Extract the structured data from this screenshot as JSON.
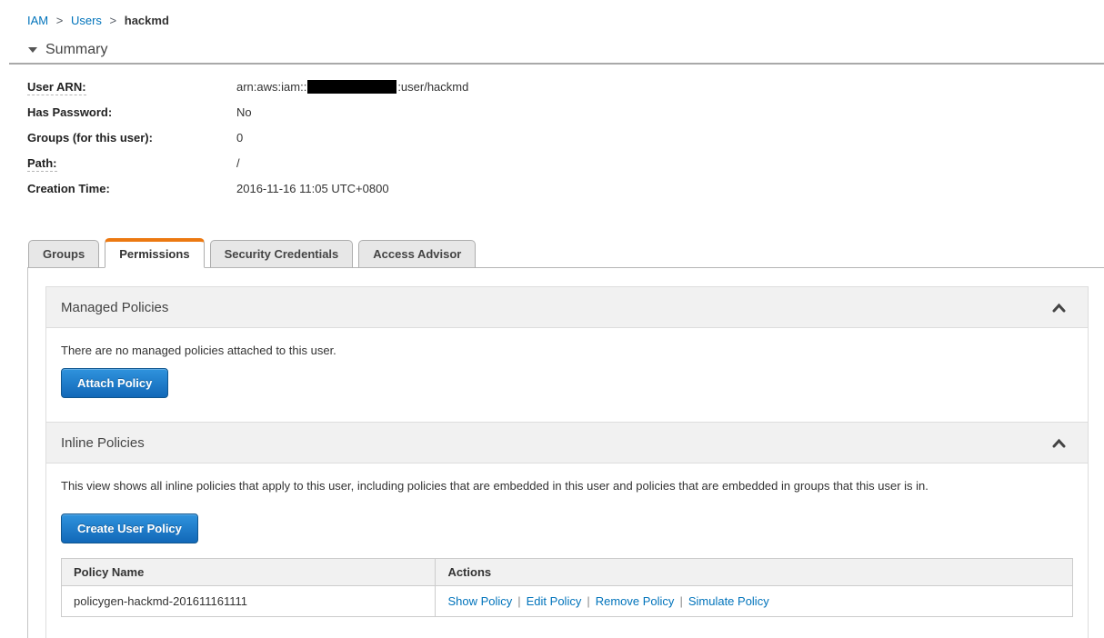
{
  "breadcrumb": {
    "separator": ">",
    "items": [
      "IAM",
      "Users",
      "hackmd"
    ]
  },
  "summary": {
    "title": "Summary",
    "rows": [
      {
        "label": "User ARN:",
        "value_prefix": "arn:aws:iam::",
        "value_suffix": ":user/hackmd"
      },
      {
        "label": "Has Password:",
        "value": "No"
      },
      {
        "label": "Groups (for this user):",
        "value": "0"
      },
      {
        "label": "Path:",
        "value": "/"
      },
      {
        "label": "Creation Time:",
        "value": "2016-11-16 11:05 UTC+0800"
      }
    ]
  },
  "tabs": {
    "active": "Permissions",
    "items": [
      {
        "label": "Groups"
      },
      {
        "label": "Permissions"
      },
      {
        "label": "Security Credentials"
      },
      {
        "label": "Access Advisor"
      }
    ]
  },
  "managed_policies": {
    "title": "Managed Policies",
    "empty_text": "There are no managed policies attached to this user.",
    "attach_button_label": "Attach Policy"
  },
  "inline_policies": {
    "title": "Inline Policies",
    "description": "This view shows all inline policies that apply to this user, including policies that are embedded in this user and policies that are embedded in groups that this user is in.",
    "create_button_label": "Create User Policy",
    "table": {
      "headers": {
        "policy_name": "Policy Name",
        "actions": "Actions"
      },
      "action_separator": "|",
      "rows": [
        {
          "policy_name": "policygen-hackmd-201611161111",
          "actions": {
            "show": "Show Policy",
            "edit": "Edit Policy",
            "remove": "Remove Policy",
            "simulate": "Simulate Policy"
          }
        }
      ]
    }
  },
  "colors": {
    "link_blue": "#0073bb",
    "active_tab_orange": "#ec7911",
    "button_gradient_top": "#2f93dd",
    "button_gradient_bottom": "#1268b8",
    "section_header_bg": "#f1f1f1"
  }
}
